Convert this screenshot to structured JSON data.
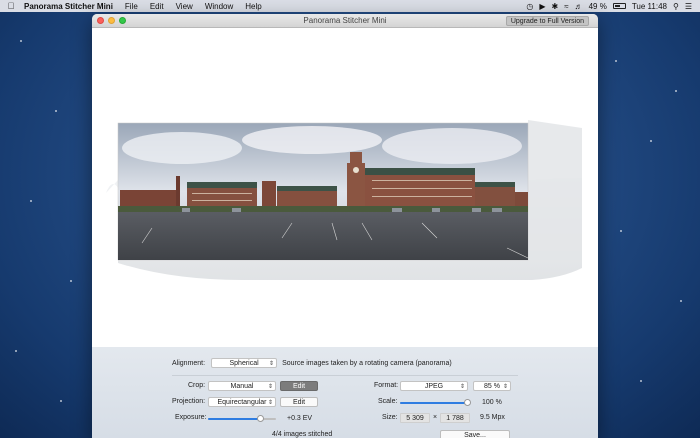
{
  "menubar": {
    "app_name": "Panorama Stitcher Mini",
    "menus": [
      "File",
      "Edit",
      "View",
      "Window",
      "Help"
    ],
    "battery_percent": "49 %",
    "battery_level": 0.49,
    "clock": "Tue 11:48"
  },
  "window": {
    "title": "Panorama Stitcher Mini",
    "upgrade_label": "Upgrade to Full Version"
  },
  "controls": {
    "alignment": {
      "label": "Alignment:",
      "value": "Spherical",
      "description": "Source images taken by a rotating camera (panorama)"
    },
    "crop": {
      "label": "Crop:",
      "value": "Manual",
      "edit_label": "Edit"
    },
    "projection": {
      "label": "Projection:",
      "value": "Equirectangular",
      "edit_label": "Edit"
    },
    "exposure": {
      "label": "Exposure:",
      "value_text": "+0.3 EV",
      "level": 0.78
    },
    "format": {
      "label": "Format:",
      "value": "JPEG",
      "quality": "85 %"
    },
    "scale": {
      "label": "Scale:",
      "value_text": "100 %",
      "level": 1.0
    },
    "size": {
      "label": "Size:",
      "width": "5 309",
      "times": "×",
      "height": "1 788",
      "megapixels": "9.5 Mpx"
    },
    "status": "4/4 images stitched",
    "save_label": "Save..."
  },
  "colors": {
    "accent": "#2f7de1",
    "close": "#fc605b",
    "minimize": "#fdbc40",
    "maximize": "#34c84a"
  }
}
